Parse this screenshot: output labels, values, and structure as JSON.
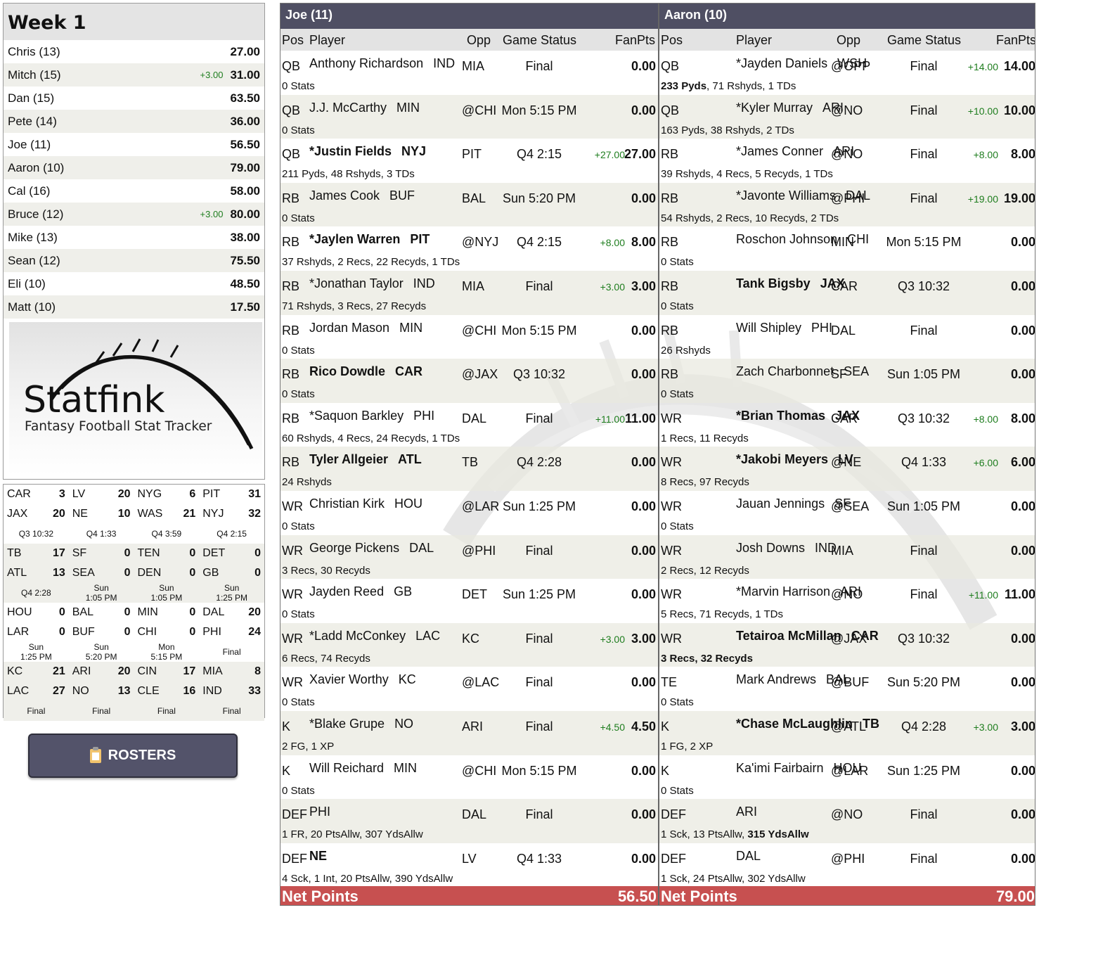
{
  "standings": {
    "title": "Week 1",
    "rows": [
      {
        "name": "Chris (13)",
        "bonus": "",
        "score": "27.00"
      },
      {
        "name": "Mitch (15)",
        "bonus": "+3.00",
        "score": "31.00"
      },
      {
        "name": "Dan (15)",
        "bonus": "",
        "score": "63.50"
      },
      {
        "name": "Pete (14)",
        "bonus": "",
        "score": "36.00"
      },
      {
        "name": "Joe (11)",
        "bonus": "",
        "score": "56.50"
      },
      {
        "name": "Aaron (10)",
        "bonus": "",
        "score": "79.00"
      },
      {
        "name": "Cal (16)",
        "bonus": "",
        "score": "58.00"
      },
      {
        "name": "Bruce (12)",
        "bonus": "+3.00",
        "score": "80.00"
      },
      {
        "name": "Mike (13)",
        "bonus": "",
        "score": "38.00"
      },
      {
        "name": "Sean (12)",
        "bonus": "",
        "score": "75.50"
      },
      {
        "name": "Eli (10)",
        "bonus": "",
        "score": "48.50"
      },
      {
        "name": "Matt (10)",
        "bonus": "",
        "score": "17.50"
      }
    ]
  },
  "logo": {
    "brand": "Statfink",
    "tagline": "Fantasy Football Stat Tracker"
  },
  "scoreboard": [
    [
      {
        "away": "CAR",
        "away_pts": "3",
        "home": "JAX",
        "home_pts": "20",
        "status": "Q3 10:32"
      },
      {
        "away": "LV",
        "away_pts": "20",
        "home": "NE",
        "home_pts": "10",
        "status": "Q4 1:33"
      },
      {
        "away": "NYG",
        "away_pts": "6",
        "home": "WAS",
        "home_pts": "21",
        "status": "Q4 3:59"
      },
      {
        "away": "PIT",
        "away_pts": "31",
        "home": "NYJ",
        "home_pts": "32",
        "status": "Q4 2:15"
      }
    ],
    [
      {
        "away": "TB",
        "away_pts": "17",
        "home": "ATL",
        "home_pts": "13",
        "status": "Q4 2:28"
      },
      {
        "away": "SF",
        "away_pts": "0",
        "home": "SEA",
        "home_pts": "0",
        "status": "Sun\n1:05 PM"
      },
      {
        "away": "TEN",
        "away_pts": "0",
        "home": "DEN",
        "home_pts": "0",
        "status": "Sun\n1:05 PM"
      },
      {
        "away": "DET",
        "away_pts": "0",
        "home": "GB",
        "home_pts": "0",
        "status": "Sun\n1:25 PM"
      }
    ],
    [
      {
        "away": "HOU",
        "away_pts": "0",
        "home": "LAR",
        "home_pts": "0",
        "status": "Sun\n1:25 PM"
      },
      {
        "away": "BAL",
        "away_pts": "0",
        "home": "BUF",
        "home_pts": "0",
        "status": "Sun\n5:20 PM"
      },
      {
        "away": "MIN",
        "away_pts": "0",
        "home": "CHI",
        "home_pts": "0",
        "status": "Mon\n5:15 PM"
      },
      {
        "away": "DAL",
        "away_pts": "20",
        "home": "PHI",
        "home_pts": "24",
        "status": "Final"
      }
    ],
    [
      {
        "away": "KC",
        "away_pts": "21",
        "home": "LAC",
        "home_pts": "27",
        "status": "Final"
      },
      {
        "away": "ARI",
        "away_pts": "20",
        "home": "NO",
        "home_pts": "13",
        "status": "Final"
      },
      {
        "away": "CIN",
        "away_pts": "17",
        "home": "CLE",
        "home_pts": "16",
        "status": "Final"
      },
      {
        "away": "MIA",
        "away_pts": "8",
        "home": "IND",
        "home_pts": "33",
        "status": "Final"
      }
    ]
  ],
  "rosters_button": {
    "label": "ROSTERS",
    "icon": "clipboard-icon"
  },
  "columns": {
    "pos": "Pos",
    "player": "Player",
    "opp": "Opp",
    "status": "Game Status",
    "fanpts": "FanPts"
  },
  "teams": [
    {
      "key": "joe",
      "header": "Joe (11)",
      "net_label": "Net Points",
      "net_points": "56.50",
      "players": [
        {
          "pos": "QB",
          "name": "Anthony Richardson",
          "nfl": "IND",
          "bold": false,
          "opp": "MIA",
          "status": "Final",
          "bonus": "",
          "fp": "0.00",
          "stats": "0 Stats",
          "stats_bold": ""
        },
        {
          "pos": "QB",
          "name": "J.J. McCarthy",
          "nfl": "MIN",
          "bold": false,
          "opp": "@CHI",
          "status": "Mon 5:15 PM",
          "bonus": "",
          "fp": "0.00",
          "stats": "0 Stats",
          "stats_bold": ""
        },
        {
          "pos": "QB",
          "name": "*Justin Fields",
          "nfl": "NYJ",
          "bold": true,
          "opp": "PIT",
          "status": "Q4 2:15",
          "bonus": "+27.00",
          "fp": "27.00",
          "stats": "211 Pyds, 48 Rshyds, 3 TDs",
          "stats_bold": ""
        },
        {
          "pos": "RB",
          "name": "James Cook",
          "nfl": "BUF",
          "bold": false,
          "opp": "BAL",
          "status": "Sun 5:20 PM",
          "bonus": "",
          "fp": "0.00",
          "stats": "0 Stats",
          "stats_bold": ""
        },
        {
          "pos": "RB",
          "name": "*Jaylen Warren",
          "nfl": "PIT",
          "bold": true,
          "opp": "@NYJ",
          "status": "Q4 2:15",
          "bonus": "+8.00",
          "fp": "8.00",
          "stats": "37 Rshyds, 2 Recs, 22 Recyds, 1 TDs",
          "stats_bold": ""
        },
        {
          "pos": "RB",
          "name": "*Jonathan Taylor",
          "nfl": "IND",
          "bold": false,
          "opp": "MIA",
          "status": "Final",
          "bonus": "+3.00",
          "fp": "3.00",
          "stats": "71 Rshyds, 3 Recs, 27 Recyds",
          "stats_bold": ""
        },
        {
          "pos": "RB",
          "name": "Jordan Mason",
          "nfl": "MIN",
          "bold": false,
          "opp": "@CHI",
          "status": "Mon 5:15 PM",
          "bonus": "",
          "fp": "0.00",
          "stats": "0 Stats",
          "stats_bold": ""
        },
        {
          "pos": "RB",
          "name": "Rico Dowdle",
          "nfl": "CAR",
          "bold": true,
          "opp": "@JAX",
          "status": "Q3 10:32",
          "bonus": "",
          "fp": "0.00",
          "stats": "0 Stats",
          "stats_bold": ""
        },
        {
          "pos": "RB",
          "name": "*Saquon Barkley",
          "nfl": "PHI",
          "bold": false,
          "opp": "DAL",
          "status": "Final",
          "bonus": "+11.00",
          "fp": "11.00",
          "stats": "60 Rshyds, 4 Recs, 24 Recyds, 1 TDs",
          "stats_bold": ""
        },
        {
          "pos": "RB",
          "name": "Tyler Allgeier",
          "nfl": "ATL",
          "bold": true,
          "opp": "TB",
          "status": "Q4 2:28",
          "bonus": "",
          "fp": "0.00",
          "stats": "24 Rshyds",
          "stats_bold": ""
        },
        {
          "pos": "WR",
          "name": "Christian Kirk",
          "nfl": "HOU",
          "bold": false,
          "opp": "@LAR",
          "status": "Sun 1:25 PM",
          "bonus": "",
          "fp": "0.00",
          "stats": "0 Stats",
          "stats_bold": ""
        },
        {
          "pos": "WR",
          "name": "George Pickens",
          "nfl": "DAL",
          "bold": false,
          "opp": "@PHI",
          "status": "Final",
          "bonus": "",
          "fp": "0.00",
          "stats": "3 Recs, 30 Recyds",
          "stats_bold": ""
        },
        {
          "pos": "WR",
          "name": "Jayden Reed",
          "nfl": "GB",
          "bold": false,
          "opp": "DET",
          "status": "Sun 1:25 PM",
          "bonus": "",
          "fp": "0.00",
          "stats": "0 Stats",
          "stats_bold": ""
        },
        {
          "pos": "WR",
          "name": "*Ladd McConkey",
          "nfl": "LAC",
          "bold": false,
          "opp": "KC",
          "status": "Final",
          "bonus": "+3.00",
          "fp": "3.00",
          "stats": "6 Recs, 74 Recyds",
          "stats_bold": ""
        },
        {
          "pos": "WR",
          "name": "Xavier Worthy",
          "nfl": "KC",
          "bold": false,
          "opp": "@LAC",
          "status": "Final",
          "bonus": "",
          "fp": "0.00",
          "stats": "0 Stats",
          "stats_bold": ""
        },
        {
          "pos": "K",
          "name": "*Blake Grupe",
          "nfl": "NO",
          "bold": false,
          "opp": "ARI",
          "status": "Final",
          "bonus": "+4.50",
          "fp": "4.50",
          "stats": "2 FG, 1 XP",
          "stats_bold": ""
        },
        {
          "pos": "K",
          "name": "Will Reichard",
          "nfl": "MIN",
          "bold": false,
          "opp": "@CHI",
          "status": "Mon 5:15 PM",
          "bonus": "",
          "fp": "0.00",
          "stats": "0 Stats",
          "stats_bold": ""
        },
        {
          "pos": "DEF",
          "name": "PHI",
          "nfl": "",
          "bold": false,
          "opp": "DAL",
          "status": "Final",
          "bonus": "",
          "fp": "0.00",
          "stats": "1 FR, 20 PtsAllw, 307 YdsAllw",
          "stats_bold": ""
        },
        {
          "pos": "DEF",
          "name": "NE",
          "nfl": "",
          "bold": true,
          "opp": "LV",
          "status": "Q4 1:33",
          "bonus": "",
          "fp": "0.00",
          "stats": "4 Sck, 1 Int, 20 PtsAllw, 390 YdsAllw",
          "stats_bold": ""
        }
      ]
    },
    {
      "key": "aaron",
      "header": "Aaron (10)",
      "net_label": "Net Points",
      "net_points": "79.00",
      "players": [
        {
          "pos": "QB",
          "name": "*Jayden Daniels",
          "nfl": "WSH",
          "bold": false,
          "opp": "@OPP",
          "status": "Final",
          "bonus": "+14.00",
          "fp": "14.00",
          "stats": ", 71 Rshyds, 1 TDs",
          "stats_bold": "233 Pyds"
        },
        {
          "pos": "QB",
          "name": "*Kyler Murray",
          "nfl": "ARI",
          "bold": false,
          "opp": "@NO",
          "status": "Final",
          "bonus": "+10.00",
          "fp": "10.00",
          "stats": "163 Pyds, 38 Rshyds, 2 TDs",
          "stats_bold": ""
        },
        {
          "pos": "RB",
          "name": "*James Conner",
          "nfl": "ARI",
          "bold": false,
          "opp": "@NO",
          "status": "Final",
          "bonus": "+8.00",
          "fp": "8.00",
          "stats": "39 Rshyds, 4 Recs, 5 Recyds, 1 TDs",
          "stats_bold": ""
        },
        {
          "pos": "RB",
          "name": "*Javonte Williams",
          "nfl": "DAL",
          "bold": false,
          "opp": "@PHI",
          "status": "Final",
          "bonus": "+19.00",
          "fp": "19.00",
          "stats": "54 Rshyds, 2 Recs, 10 Recyds, 2 TDs",
          "stats_bold": ""
        },
        {
          "pos": "RB",
          "name": "Roschon Johnson",
          "nfl": "CHI",
          "bold": false,
          "opp": "MIN",
          "status": "Mon 5:15 PM",
          "bonus": "",
          "fp": "0.00",
          "stats": "0 Stats",
          "stats_bold": ""
        },
        {
          "pos": "RB",
          "name": "Tank Bigsby",
          "nfl": "JAX",
          "bold": true,
          "opp": "CAR",
          "status": "Q3 10:32",
          "bonus": "",
          "fp": "0.00",
          "stats": "0 Stats",
          "stats_bold": ""
        },
        {
          "pos": "RB",
          "name": "Will Shipley",
          "nfl": "PHI",
          "bold": false,
          "opp": "DAL",
          "status": "Final",
          "bonus": "",
          "fp": "0.00",
          "stats": "26 Rshyds",
          "stats_bold": ""
        },
        {
          "pos": "RB",
          "name": "Zach Charbonnet",
          "nfl": "SEA",
          "bold": false,
          "opp": "SF",
          "status": "Sun 1:05 PM",
          "bonus": "",
          "fp": "0.00",
          "stats": "0 Stats",
          "stats_bold": ""
        },
        {
          "pos": "WR",
          "name": "*Brian Thomas",
          "nfl": "JAX",
          "bold": true,
          "opp": "CAR",
          "status": "Q3 10:32",
          "bonus": "+8.00",
          "fp": "8.00",
          "stats": "1 Recs, 11 Recyds",
          "stats_bold": ""
        },
        {
          "pos": "WR",
          "name": "*Jakobi Meyers",
          "nfl": "LV",
          "bold": true,
          "opp": "@NE",
          "status": "Q4 1:33",
          "bonus": "+6.00",
          "fp": "6.00",
          "stats": "8 Recs, 97 Recyds",
          "stats_bold": ""
        },
        {
          "pos": "WR",
          "name": "Jauan Jennings",
          "nfl": "SF",
          "bold": false,
          "opp": "@SEA",
          "status": "Sun 1:05 PM",
          "bonus": "",
          "fp": "0.00",
          "stats": "0 Stats",
          "stats_bold": ""
        },
        {
          "pos": "WR",
          "name": "Josh Downs",
          "nfl": "IND",
          "bold": false,
          "opp": "MIA",
          "status": "Final",
          "bonus": "",
          "fp": "0.00",
          "stats": "2 Recs, 12 Recyds",
          "stats_bold": ""
        },
        {
          "pos": "WR",
          "name": "*Marvin Harrison",
          "nfl": "ARI",
          "bold": false,
          "opp": "@NO",
          "status": "Final",
          "bonus": "+11.00",
          "fp": "11.00",
          "stats": "5 Recs, 71 Recyds, 1 TDs",
          "stats_bold": ""
        },
        {
          "pos": "WR",
          "name": "Tetairoa McMillan",
          "nfl": "CAR",
          "bold": true,
          "opp": "@JAX",
          "status": "Q3 10:32",
          "bonus": "",
          "fp": "0.00",
          "stats": "",
          "stats_bold": "3 Recs, 32 Recyds"
        },
        {
          "pos": "TE",
          "name": "Mark Andrews",
          "nfl": "BAL",
          "bold": false,
          "opp": "@BUF",
          "status": "Sun 5:20 PM",
          "bonus": "",
          "fp": "0.00",
          "stats": "0 Stats",
          "stats_bold": ""
        },
        {
          "pos": "K",
          "name": "*Chase McLaughlin",
          "nfl": "TB",
          "bold": true,
          "opp": "@ATL",
          "status": "Q4 2:28",
          "bonus": "+3.00",
          "fp": "3.00",
          "stats": "1 FG, 2 XP",
          "stats_bold": ""
        },
        {
          "pos": "K",
          "name": "Ka'imi Fairbairn",
          "nfl": "HOU",
          "bold": false,
          "opp": "@LAR",
          "status": "Sun 1:25 PM",
          "bonus": "",
          "fp": "0.00",
          "stats": "0 Stats",
          "stats_bold": ""
        },
        {
          "pos": "DEF",
          "name": "ARI",
          "nfl": "",
          "bold": false,
          "opp": "@NO",
          "status": "Final",
          "bonus": "",
          "fp": "0.00",
          "stats": "1 Sck, 13 PtsAllw, ",
          "stats_bold": "315 YdsAllw"
        },
        {
          "pos": "DEF",
          "name": "DAL",
          "nfl": "",
          "bold": false,
          "opp": "@PHI",
          "status": "Final",
          "bonus": "",
          "fp": "0.00",
          "stats": "1 Sck, 24 PtsAllw, 302 YdsAllw",
          "stats_bold": ""
        }
      ]
    }
  ]
}
